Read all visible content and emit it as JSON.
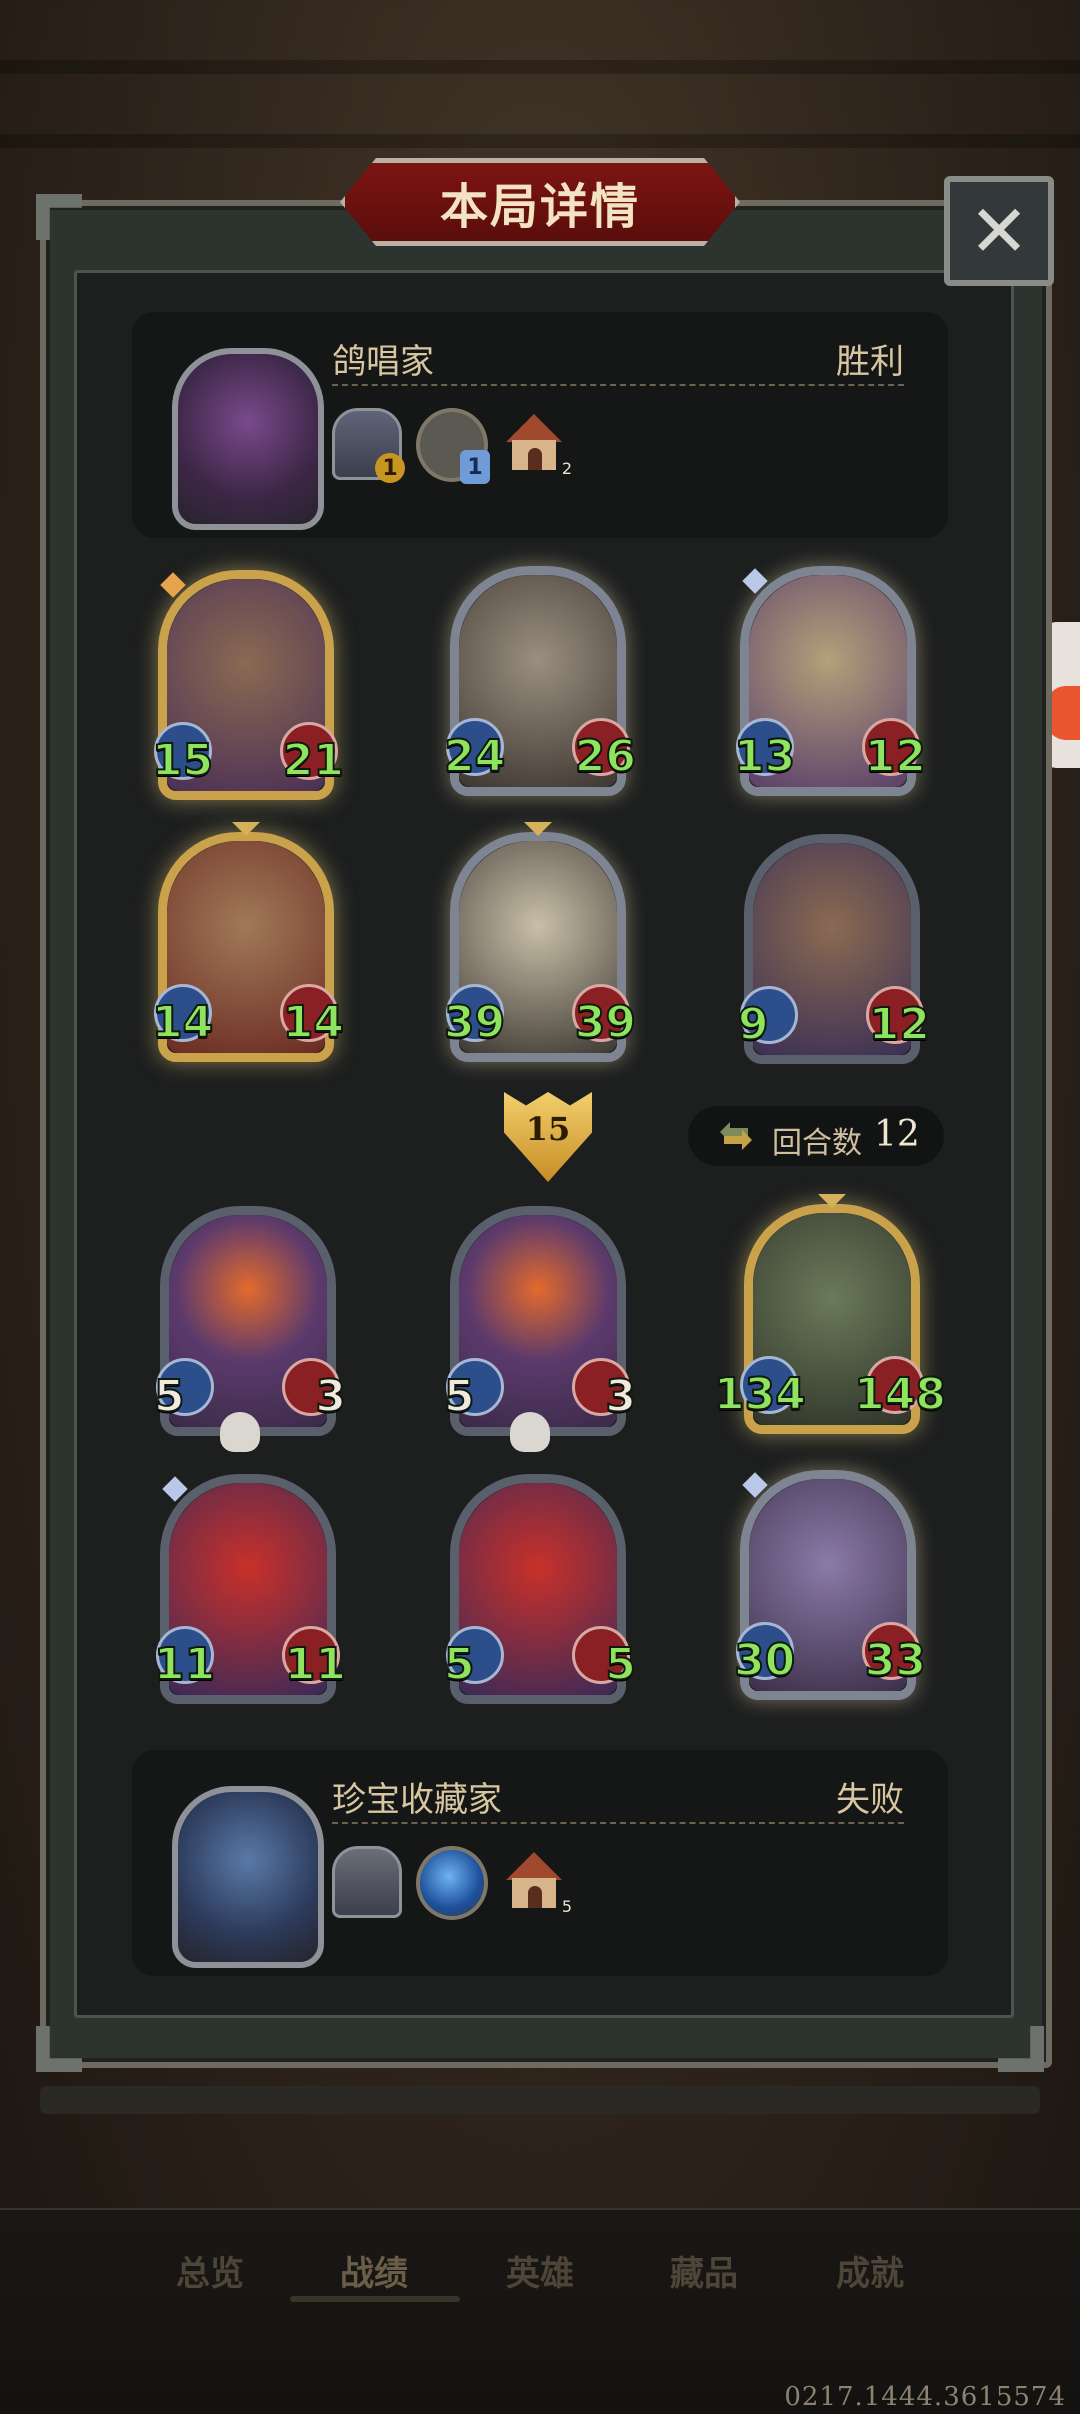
{
  "title": "本局详情",
  "close_label": "✕",
  "player_top": {
    "name": "鸽唱家",
    "result": "胜利",
    "items": [
      {
        "type": "card-frame",
        "badge": "1",
        "badge_style": "gold"
      },
      {
        "type": "round-frame",
        "badge": "1",
        "badge_style": "blue"
      },
      {
        "type": "house",
        "count": "2"
      }
    ]
  },
  "player_bottom": {
    "name": "珍宝收藏家",
    "result": "失败",
    "items": [
      {
        "type": "card-frame"
      },
      {
        "type": "round-frame"
      },
      {
        "type": "house",
        "count": "5"
      }
    ]
  },
  "top_cards": [
    {
      "attack": "15",
      "health": "21",
      "frame": "gold"
    },
    {
      "attack": "24",
      "health": "26",
      "frame": "silver"
    },
    {
      "attack": "13",
      "health": "12",
      "frame": "silver"
    },
    {
      "attack": "14",
      "health": "14",
      "frame": "gold"
    },
    {
      "attack": "39",
      "health": "39",
      "frame": "silver"
    },
    {
      "attack": "9",
      "health": "12",
      "frame": "steel"
    }
  ],
  "bottom_cards": [
    {
      "attack": "5",
      "health": "3",
      "frame": "steel"
    },
    {
      "attack": "5",
      "health": "3",
      "frame": "steel"
    },
    {
      "attack": "134",
      "health": "148",
      "frame": "gold"
    },
    {
      "attack": "11",
      "health": "11",
      "frame": "steel"
    },
    {
      "attack": "5",
      "health": "5",
      "frame": "steel"
    },
    {
      "attack": "30",
      "health": "33",
      "frame": "silver"
    }
  ],
  "damage_badge": "15",
  "round": {
    "label": "回合数",
    "value": "12"
  },
  "nav": {
    "overview": "总览",
    "records": "战绩",
    "heroes": "英雄",
    "collection": "藏品",
    "achievements": "成就"
  },
  "footer_id": "0217.1444.3615574",
  "colors": {
    "stat_green": "#8fe35e",
    "title_red": "#7d1512",
    "frame_gold": "#c9a24b"
  }
}
